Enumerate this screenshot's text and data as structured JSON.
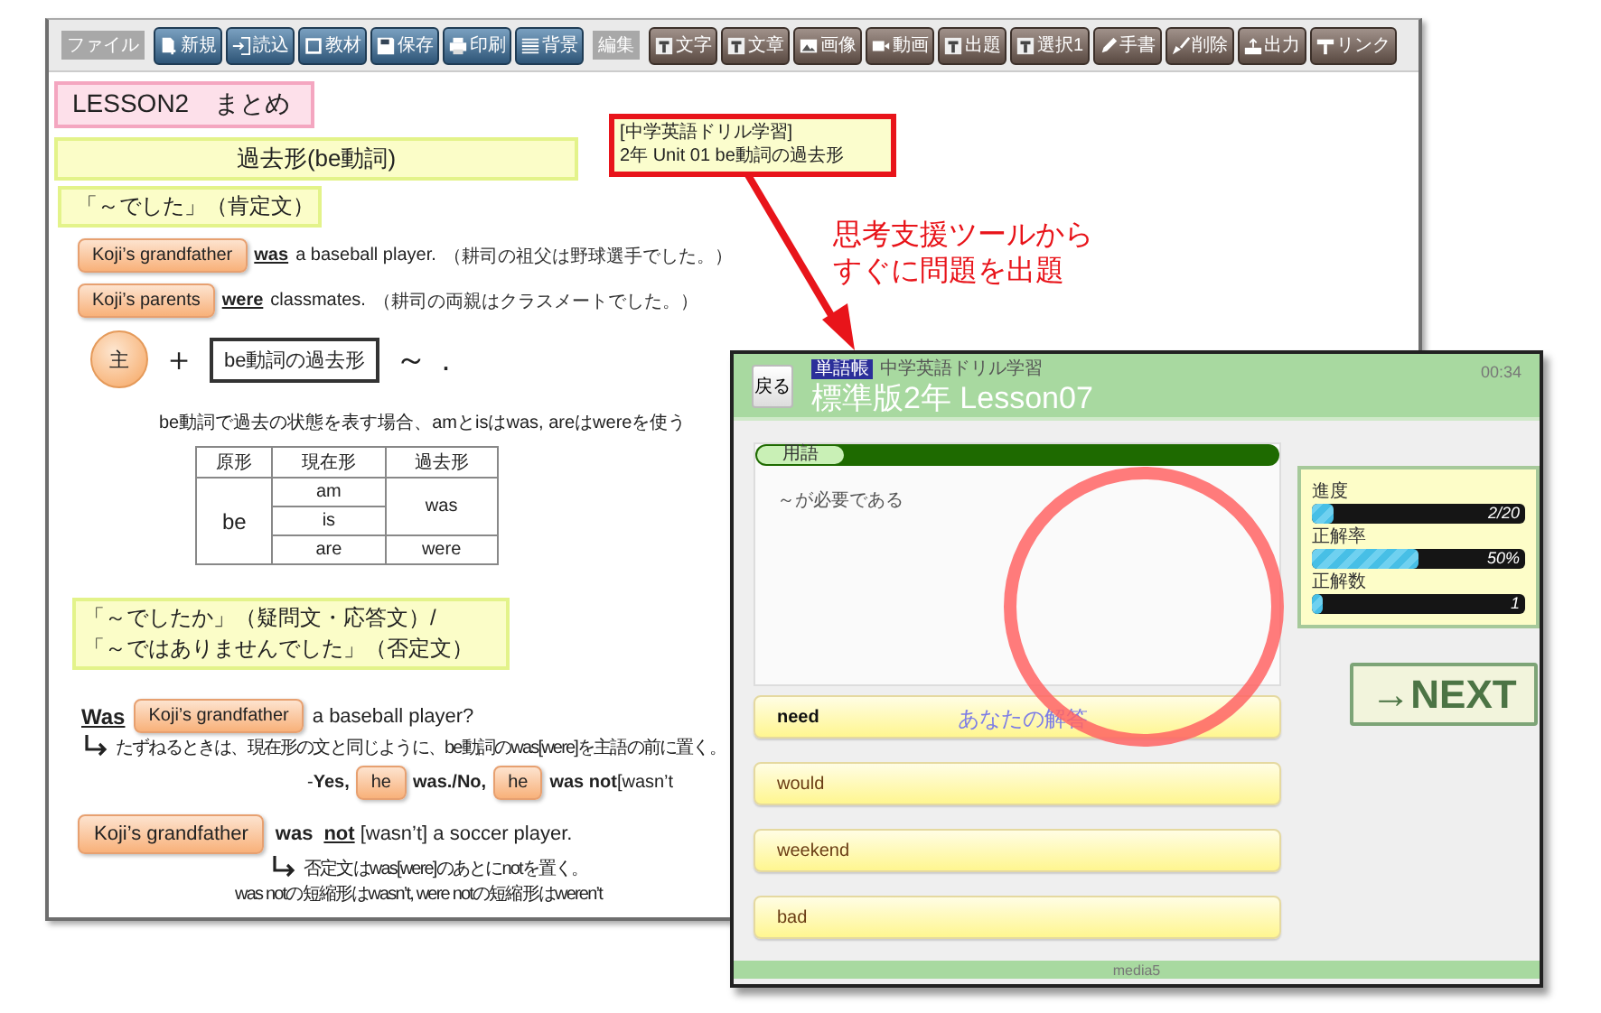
{
  "editor": {
    "toolbar": [
      {
        "label": "ファイル",
        "buttons": [
          "新規",
          "読込",
          "教材",
          "保存",
          "印刷",
          "背景"
        ]
      },
      {
        "label": "編集",
        "buttons": [
          "文字",
          "文章",
          "画像",
          "動画",
          "出題",
          "選択1",
          "手書",
          "削除",
          "出力",
          "リンク"
        ]
      }
    ],
    "title": "LESSON2　まとめ",
    "heading": "過去形(be動詞)",
    "affirmative": {
      "heading": "「～でした」（肯定文）",
      "examples": [
        {
          "subject": "Koji’s grandfather",
          "verb": "was",
          "rest": "a baseball player.",
          "note": "（耕司の祖父は野球選手でした。）"
        },
        {
          "subject": "Koji’s parents",
          "verb": "were",
          "rest": "classmates.",
          "note": "（耕司の両親はクラスメートでした。）"
        }
      ],
      "formula": {
        "subject": "主",
        "plus": "＋",
        "verb": "be動詞の過去形",
        "tilde": "～",
        "period": "."
      },
      "rule": "be動詞で過去の状態を表す場合、amとisはwas, areはwereを使う",
      "table": {
        "columns": [
          "原形",
          "現在形",
          "過去形"
        ],
        "base": "be",
        "present": [
          "am",
          "is",
          "are"
        ],
        "past": [
          "was",
          "were"
        ]
      }
    },
    "negative": {
      "heading_lines": [
        "「～でしたか」（疑問文・応答文）/",
        "「～ではありませんでした」（否定文）"
      ],
      "question": {
        "verb": "Was",
        "subject": "Koji’s grandfather",
        "rest": "a baseball player?",
        "note": "たずねるときは、現在形の文と同じように、be動詞のwas[were]を主語の前に置く。"
      },
      "answer": [
        {
          "kind": "text",
          "text": "-**Yes,**"
        },
        {
          "kind": "pill",
          "text": "he"
        },
        {
          "kind": "text",
          "text": "**was./No,**"
        },
        {
          "kind": "pill",
          "text": "he"
        },
        {
          "kind": "text",
          "text": "**was not**[wasn’t"
        }
      ],
      "negation": {
        "subject": "Koji’s grandfather",
        "pre": "was",
        "verb": "not",
        "rest": "[wasn’t] a soccer player.",
        "notes": [
          "否定文はwas[were]のあとにnotを置く。",
          "was notの短縮形はwasn’t, were notの短縮形はweren’t"
        ]
      }
    }
  },
  "callout": {
    "lines": [
      "[中学英語ドリル学習]",
      "2年 Unit 01 be動詞の過去形"
    ]
  },
  "annotation": {
    "lines": [
      "思考支援ツールから",
      "すぐに問題を出題"
    ]
  },
  "drill": {
    "back": "戻る",
    "badge": "単語帳",
    "subtitle": "中学英語ドリル学習",
    "title": "標準版2年 Lesson07",
    "timer": "00:34",
    "question": {
      "tab": "用語",
      "text": "～が必要である"
    },
    "choices": [
      {
        "text": "need",
        "selected": true
      },
      {
        "text": "would",
        "selected": false
      },
      {
        "text": "weekend",
        "selected": false
      },
      {
        "text": "bad",
        "selected": false
      }
    ],
    "answer_label": "あなたの解答",
    "stats": [
      {
        "label": "進度",
        "reading": "2/20",
        "level": 0.1
      },
      {
        "label": "正解率",
        "reading": "50%",
        "level": 0.5
      },
      {
        "label": "正解数",
        "reading": "1",
        "level": 0.05
      }
    ],
    "next": "→NEXT",
    "footer": "media5"
  }
}
